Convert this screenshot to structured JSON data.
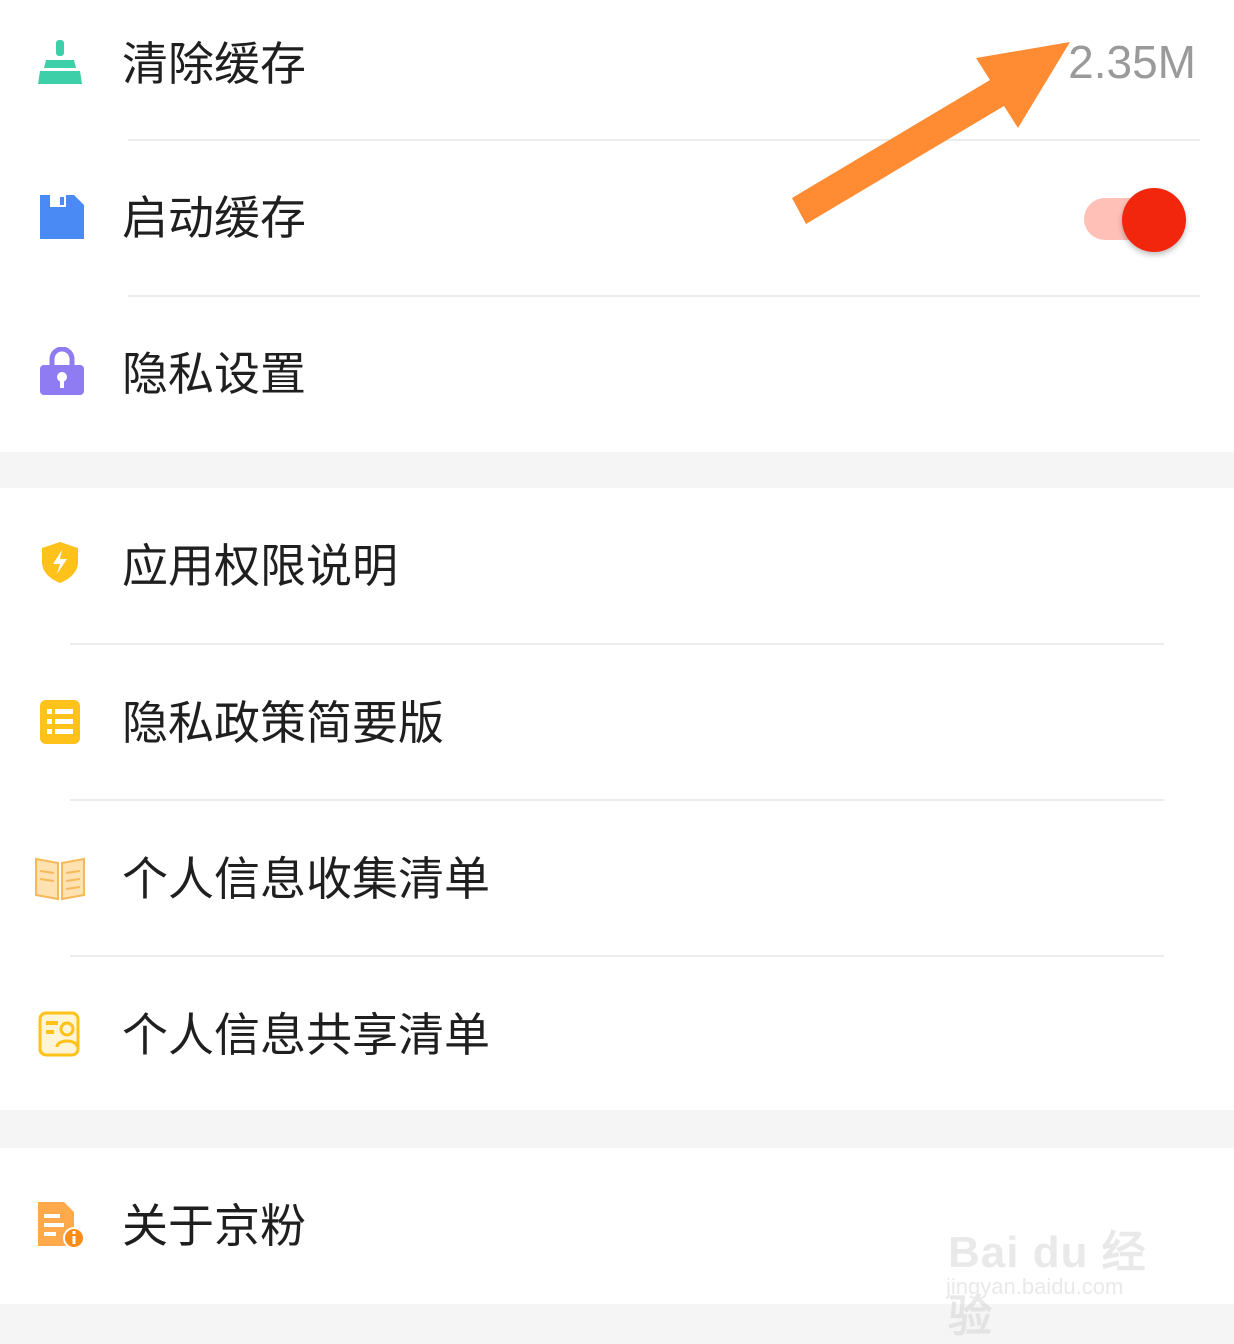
{
  "settings": {
    "group1": {
      "clear_cache": {
        "label": "清除缓存",
        "value": "2.35M",
        "icon": "broom-icon"
      },
      "startup_cache": {
        "label": "启动缓存",
        "icon": "floppy-disk-icon",
        "toggle_on": true
      },
      "privacy_settings": {
        "label": "隐私设置",
        "icon": "lock-icon"
      }
    },
    "group2": {
      "app_permissions": {
        "label": "应用权限说明",
        "icon": "shield-icon"
      },
      "privacy_policy_brief": {
        "label": "隐私政策简要版",
        "icon": "list-icon"
      },
      "personal_info_collection": {
        "label": "个人信息收集清单",
        "icon": "book-icon"
      },
      "personal_info_sharing": {
        "label": "个人信息共享清单",
        "icon": "contact-card-icon"
      }
    },
    "group3": {
      "about": {
        "label": "关于京粉",
        "icon": "document-info-icon"
      }
    }
  },
  "watermark": {
    "logo_text": "Bai du 经验",
    "url": "jingyan.baidu.com"
  },
  "colors": {
    "accent_orange": "#ff8c33",
    "toggle_on": "#f2260d",
    "toggle_track": "#ffc0b8",
    "broom_icon": "#3ccfa8",
    "floppy_icon": "#4a8af4",
    "lock_icon": "#8f7cf2",
    "yellow_icons": "#ffc21a"
  }
}
